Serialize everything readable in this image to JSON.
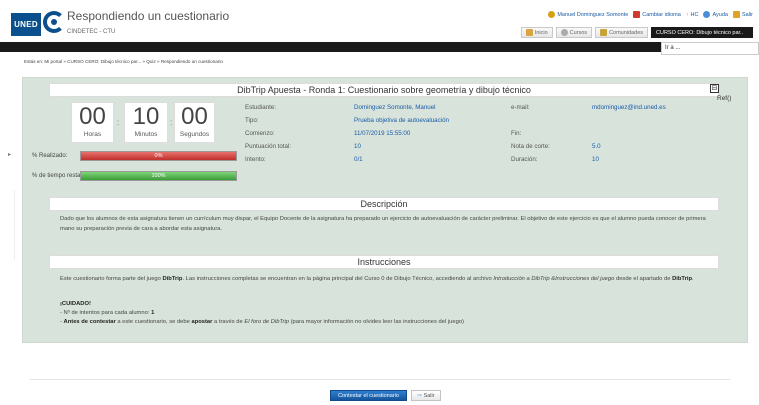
{
  "header": {
    "logo_text": "UNED",
    "title": "Respondiendo un cuestionario",
    "subtitle": "CINDETEC - CTU",
    "links": [
      {
        "label": "Manuel Dominguez Somonte",
        "icon": "user-icon",
        "color": "#d4a017"
      },
      {
        "label": "Cambiar idioma",
        "icon": "language-flag-icon",
        "color": "#d13b2e"
      },
      {
        "label": "HC",
        "icon": "hc-icon",
        "color": "#888888"
      },
      {
        "label": "Ayuda",
        "icon": "help-icon",
        "color": "#4a8fd6"
      },
      {
        "label": "Salir",
        "icon": "exit-icon",
        "color": "#e0a32a"
      }
    ],
    "tabs": [
      {
        "label": "Inicio",
        "icon": "home-icon"
      },
      {
        "label": "Cursos",
        "icon": "courses-icon"
      },
      {
        "label": "Comunidades",
        "icon": "communities-icon"
      },
      {
        "label": "CURSO CERO: Dibujo técnico par..",
        "icon": ""
      }
    ],
    "goto": "Ir a ..."
  },
  "breadcrumb": "Estás en: Mi portal » CURSO CERO: Dibujo técnico par... » Quiz » Respondiendo un cuestionario",
  "quiz": {
    "title": "DibTrip Apuesta - Ronda 1: Cuestionario sobre geometría y dibujo técnico",
    "collapse_symbol": "⊟",
    "ref": "Ref()",
    "timer": {
      "hours": "00",
      "hours_label": "Horas",
      "minutes": "10",
      "minutes_label": "Minutos",
      "seconds": "00",
      "seconds_label": "Segundos",
      "separator": ":"
    },
    "info": {
      "estudiante_label": "Estudiante:",
      "estudiante": "Dominguez Somonte, Manuel",
      "tipo_label": "Tipo:",
      "tipo": "Prueba objetiva de autoevaluación",
      "comienzo_label": "Comienzo:",
      "comienzo": "11/07/2019 15:55:00",
      "puntuacion_label": "Puntuación total:",
      "puntuacion": "10",
      "intento_label": "Intento:",
      "intento": "0/1",
      "email_label": "e-mail:",
      "email": "mdominguez@ind.uned.es",
      "fin_label": "Fin:",
      "fin": "",
      "nota_label": "Nota de corte:",
      "nota": "5.0",
      "duracion_label": "Duración:",
      "duracion": "10"
    },
    "progress": {
      "realizado_label": "% Realizado:",
      "realizado_text": "0%",
      "realizado_value": 0,
      "tiempo_label": "% de tiempo restante:",
      "tiempo_text": "100%",
      "tiempo_value": 100
    }
  },
  "descripcion": {
    "heading": "Descripción",
    "text": "Dado que los alumnos de esta asignatura tienen un currículum muy dispar, el Equipo Docente de la asignatura ha preparado un ejercicio de autoevaluación de carácter preliminar. El objetivo de este ejercicio es que el alumno pueda conocer de primera mano su preparación previa de cara a abordar esta asignatura."
  },
  "instrucciones": {
    "heading": "Instrucciones",
    "p1_a": "Este cuestionario forma parte del juego ",
    "p1_b": "DibTrip",
    "p1_c": ". Las instrucciones completas se encuentran en la página principal del Curso 0 de Dibujo Técnico, accediendo al archivo ",
    "p1_d": "Introducción a DibTrip &Instrucciones del juego",
    "p1_e": " desde el apartado de ",
    "p1_f": "DibTrip",
    "p1_g": ".",
    "cuidado": "¡CUIDADO!",
    "li1_a": "- Nº de intentos para cada alumno: ",
    "li1_b": "1",
    "li2_a": "- ",
    "li2_b": "Antes de contestar",
    "li2_c": " a este cuestionario, se debe ",
    "li2_d": "apostar",
    "li2_e": " a través de ",
    "li2_f": "El foro de DibTrip",
    "li2_g": " (para mayor información no olvides leer las instrucciones del juego)"
  },
  "actions": {
    "contestar": "Contestar el cuestionario",
    "salir": "Salir",
    "salir_icon": "⇨"
  },
  "colors": {
    "panel": "#d8e4db",
    "accent_blue": "#1a5aa8",
    "bar_red": "#c0302c",
    "bar_green": "#3c9c37"
  }
}
